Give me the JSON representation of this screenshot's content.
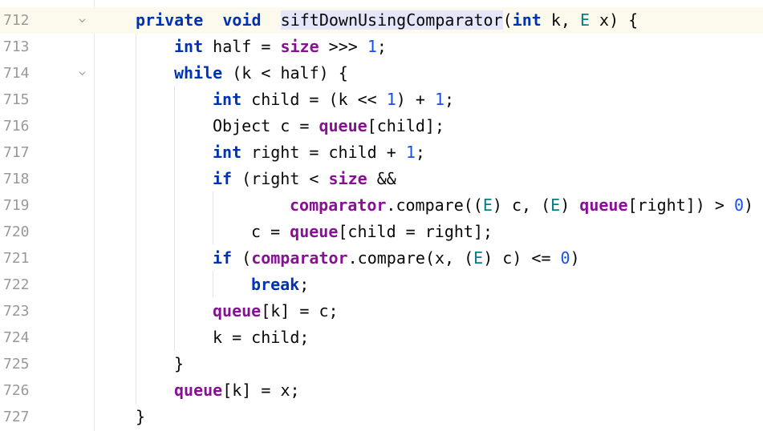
{
  "editor": {
    "lines": [
      {
        "num": "712",
        "indent": 0,
        "current": true,
        "foldable": true,
        "tokens": [
          [
            "kw",
            "private"
          ],
          [
            "",
            "  "
          ],
          [
            "kw",
            "void"
          ],
          [
            "",
            "  "
          ],
          [
            "decl",
            "siftDownUsingComparator"
          ],
          [
            "",
            "("
          ],
          [
            "kw",
            "int"
          ],
          [
            "",
            " k, "
          ],
          [
            "tp",
            "E"
          ],
          [
            "",
            " x) {"
          ]
        ]
      },
      {
        "num": "713",
        "indent": 1,
        "tokens": [
          [
            "kw",
            "int"
          ],
          [
            "",
            " half = "
          ],
          [
            "fld",
            "size"
          ],
          [
            "",
            " >>> "
          ],
          [
            "num",
            "1"
          ],
          [
            "",
            ";"
          ]
        ]
      },
      {
        "num": "714",
        "indent": 1,
        "foldable": true,
        "tokens": [
          [
            "kw",
            "while"
          ],
          [
            "",
            " (k < half) {"
          ]
        ]
      },
      {
        "num": "715",
        "indent": 2,
        "tokens": [
          [
            "kw",
            "int"
          ],
          [
            "",
            " child = (k << "
          ],
          [
            "num",
            "1"
          ],
          [
            "",
            ") + "
          ],
          [
            "num",
            "1"
          ],
          [
            "",
            ";"
          ]
        ]
      },
      {
        "num": "716",
        "indent": 2,
        "tokens": [
          [
            "",
            "Object c = "
          ],
          [
            "fld",
            "queue"
          ],
          [
            "",
            "[child];"
          ]
        ]
      },
      {
        "num": "717",
        "indent": 2,
        "tokens": [
          [
            "kw",
            "int"
          ],
          [
            "",
            " right = child + "
          ],
          [
            "num",
            "1"
          ],
          [
            "",
            ";"
          ]
        ]
      },
      {
        "num": "718",
        "indent": 2,
        "tokens": [
          [
            "kw",
            "if"
          ],
          [
            "",
            " (right < "
          ],
          [
            "fld",
            "size"
          ],
          [
            "",
            " &&"
          ]
        ]
      },
      {
        "num": "719",
        "indent": 3,
        "tokens": [
          [
            "fld",
            "comparator"
          ],
          [
            "",
            ".compare(("
          ],
          [
            "tp",
            "E"
          ],
          [
            "",
            ") c, ("
          ],
          [
            "tp",
            "E"
          ],
          [
            "",
            ") "
          ],
          [
            "fld",
            "queue"
          ],
          [
            "",
            "[right]) > "
          ],
          [
            "num",
            "0"
          ],
          [
            "",
            ")"
          ]
        ]
      },
      {
        "num": "720",
        "indent": 4,
        "tokens": [
          [
            "",
            "c = "
          ],
          [
            "fld",
            "queue"
          ],
          [
            "",
            "[child = right];"
          ]
        ]
      },
      {
        "num": "721",
        "indent": 2,
        "tokens": [
          [
            "kw",
            "if"
          ],
          [
            "",
            " ("
          ],
          [
            "fld",
            "comparator"
          ],
          [
            "",
            ".compare(x, ("
          ],
          [
            "tp",
            "E"
          ],
          [
            "",
            ") c) <= "
          ],
          [
            "num",
            "0"
          ],
          [
            "",
            ")"
          ]
        ]
      },
      {
        "num": "722",
        "indent": 4,
        "tokens": [
          [
            "kw",
            "break"
          ],
          [
            "",
            ";"
          ]
        ]
      },
      {
        "num": "723",
        "indent": 2,
        "tokens": [
          [
            "fld",
            "queue"
          ],
          [
            "",
            "[k] = c;"
          ]
        ]
      },
      {
        "num": "724",
        "indent": 2,
        "tokens": [
          [
            "",
            "k = child;"
          ]
        ]
      },
      {
        "num": "725",
        "indent": 1,
        "tokens": [
          [
            "",
            "}"
          ]
        ]
      },
      {
        "num": "726",
        "indent": 1,
        "tokens": [
          [
            "fld",
            "queue"
          ],
          [
            "",
            "[k] = x;"
          ]
        ]
      },
      {
        "num": "727",
        "indent": 0,
        "tokens": [
          [
            "",
            "}"
          ]
        ]
      }
    ]
  },
  "colors": {
    "keyword": "#0033b3",
    "field": "#871094",
    "number": "#1750eb",
    "type_param": "#007e8a",
    "current_line": "#fcfaed",
    "declaration_highlight": "#e6e6fa",
    "line_number": "#999999"
  },
  "icons": {
    "fold": "chevron-down-icon"
  }
}
